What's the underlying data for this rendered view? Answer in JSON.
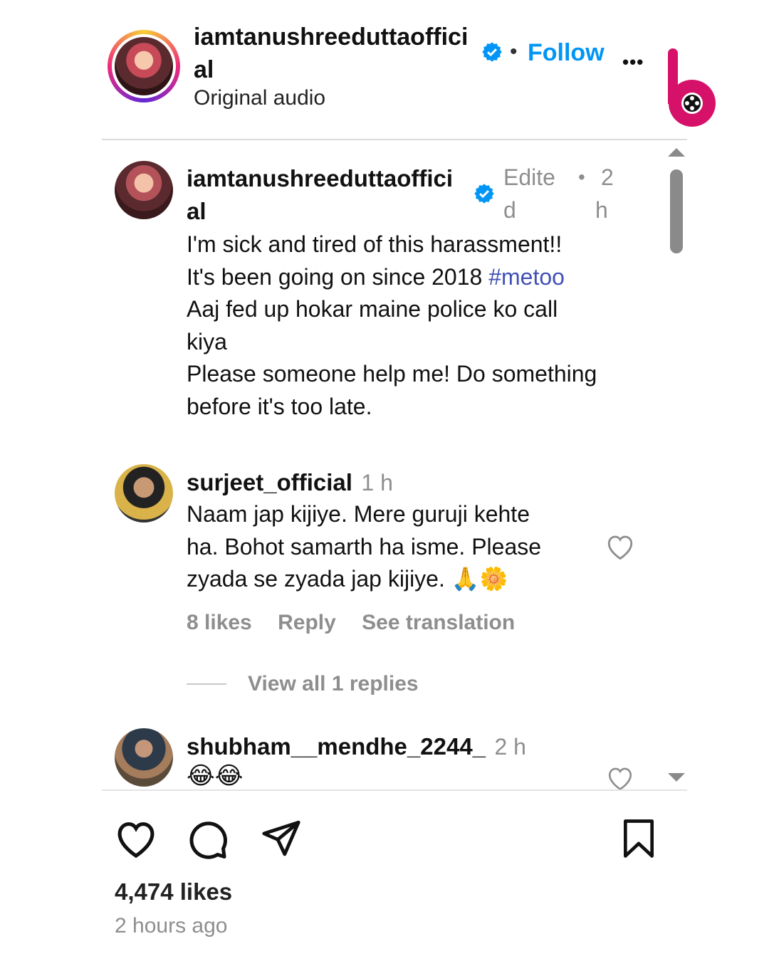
{
  "header": {
    "username_line1": "iamtanushreeduttaoffici",
    "username_line2": "al",
    "separator": "•",
    "follow_label": "Follow",
    "audio_label": "Original audio",
    "more_label": "•••"
  },
  "caption": {
    "username_line1": "iamtanushreeduttaoffici",
    "username_line2": "al",
    "edited_line1": "Edite",
    "edited_line2": "d",
    "separator": "•",
    "time_line1": "2",
    "time_line2": "h",
    "text_line1": "I'm sick and tired of this harassment!!",
    "text_line2": "It's been going on since 2018 ",
    "hashtag": "#metoo",
    "text_line3": "Aaj fed up hokar maine police ko call",
    "text_line4": "kiya",
    "text_line5": "Please someone help me! Do something",
    "text_line6": "before it's too late."
  },
  "comments": [
    {
      "username": "surjeet_official",
      "time": "1 h",
      "line1": "Naam jap kijiye. Mere guruji kehte",
      "line2": "ha. Bohot samarth ha isme. Please",
      "line3": "zyada se zyada jap kijiye. 🙏🌼",
      "likes": "8 likes",
      "reply_label": "Reply",
      "translation_label": "See translation",
      "view_replies": "View all 1 replies"
    },
    {
      "username": "shubham__mendhe_2244_",
      "time": "2 h",
      "line1": "😂😂"
    }
  ],
  "footer": {
    "likes": "4,474 likes",
    "timestamp": "2 hours ago"
  },
  "colors": {
    "accent_blue": "#0095f6",
    "verified_blue": "#0095f6",
    "hashtag": "#4150b5",
    "brand_pink": "#d6116a"
  },
  "icons": [
    "verified-badge-icon",
    "more-options-icon",
    "heart-icon",
    "comment-icon",
    "share-icon",
    "bookmark-icon",
    "brand-logo-icon"
  ]
}
